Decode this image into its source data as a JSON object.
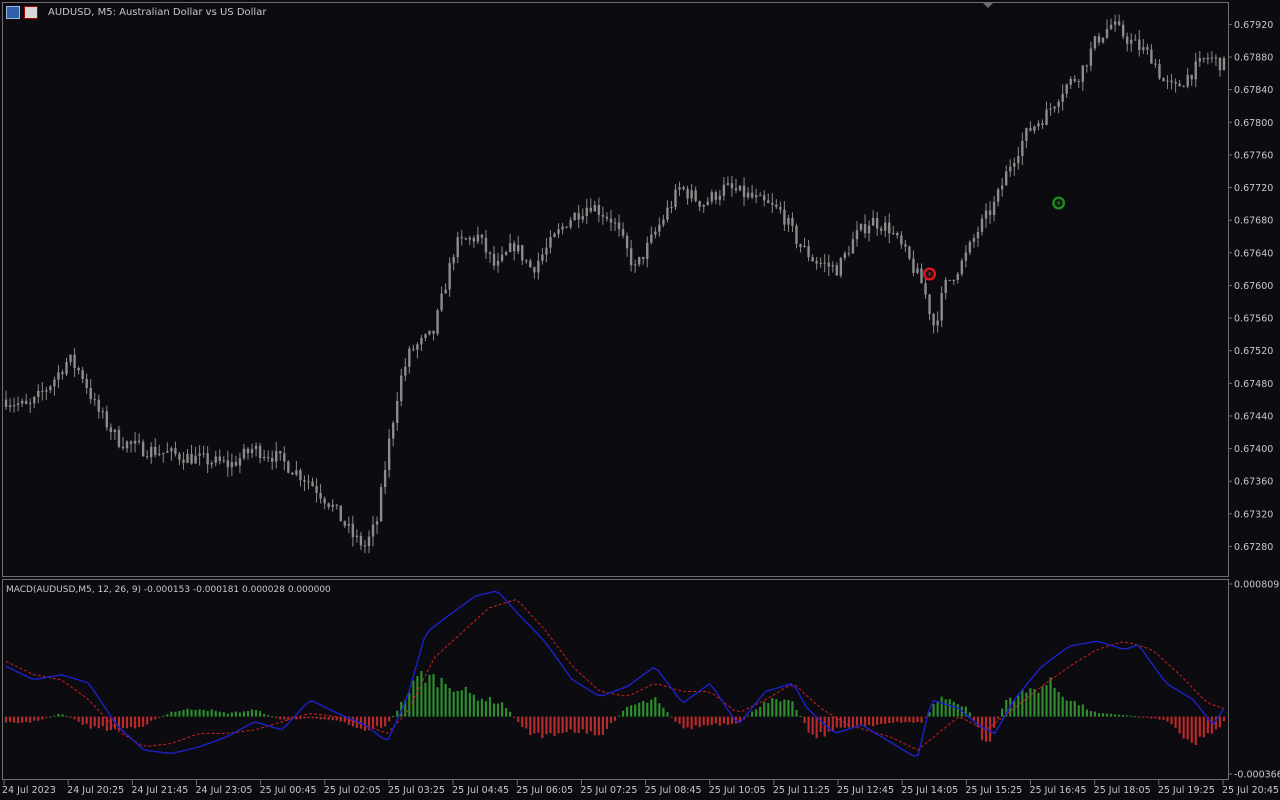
{
  "window": {
    "symbol_title": "AUDUSD, M5:  Australian Dollar vs US Dollar",
    "indicator_title": "MACD(AUDUSD,M5, 12, 26, 9) -0.000153 -0.000181 0.000028 0.000000"
  },
  "colors": {
    "background": "#0b0b10",
    "candle": "#8c8c8c",
    "frame": "#6e6e6e",
    "macd_line": "#1d22c8",
    "signal_line": "#d02020",
    "hist_up": "#2e8b2e",
    "hist_down": "#b52a2a",
    "sell_marker": "#e0141e",
    "buy_marker": "#1e8c1e"
  },
  "icons": [
    "chart-window-icon",
    "chart-properties-icon"
  ],
  "chart_data": [
    {
      "type": "candlestick",
      "title": "AUDUSD, M5:  Australian Dollar vs US Dollar",
      "y_ticks": [
        "0.67920",
        "0.67880",
        "0.67840",
        "0.67800",
        "0.67760",
        "0.67720",
        "0.67680",
        "0.67640",
        "0.67600",
        "0.67560",
        "0.67520",
        "0.67480",
        "0.67440",
        "0.67400",
        "0.67360",
        "0.67320",
        "0.67280"
      ],
      "ylim": [
        0.67245,
        0.67945
      ],
      "x_ticks": [
        "24 Jul 2023",
        "24 Jul 20:25",
        "24 Jul 21:45",
        "24 Jul 23:05",
        "25 Jul 00:45",
        "25 Jul 02:05",
        "25 Jul 03:25",
        "25 Jul 04:45",
        "25 Jul 06:05",
        "25 Jul 07:25",
        "25 Jul 08:45",
        "25 Jul 10:05",
        "25 Jul 11:25",
        "25 Jul 12:45",
        "25 Jul 14:05",
        "25 Jul 15:25",
        "25 Jul 16:45",
        "25 Jul 18:05",
        "25 Jul 19:25",
        "25 Jul 20:45"
      ],
      "bars": 303,
      "close_path": [
        [
          0,
          0.6746
        ],
        [
          10,
          0.6745
        ],
        [
          20,
          0.6748
        ],
        [
          28,
          0.6751
        ],
        [
          34,
          0.6749
        ],
        [
          40,
          0.6745
        ],
        [
          50,
          0.6741
        ],
        [
          60,
          0.674
        ],
        [
          80,
          0.6739
        ],
        [
          100,
          0.6738
        ],
        [
          110,
          0.674
        ],
        [
          120,
          0.6739
        ],
        [
          135,
          0.6736
        ],
        [
          145,
          0.6733
        ],
        [
          155,
          0.6729
        ],
        [
          160,
          0.6728
        ],
        [
          165,
          0.6731
        ],
        [
          170,
          0.674
        ],
        [
          175,
          0.6748
        ],
        [
          180,
          0.6752
        ],
        [
          190,
          0.6754
        ],
        [
          200,
          0.6765
        ],
        [
          210,
          0.6766
        ],
        [
          218,
          0.6762
        ],
        [
          226,
          0.6765
        ],
        [
          234,
          0.6762
        ],
        [
          242,
          0.6765
        ],
        [
          250,
          0.6768
        ],
        [
          260,
          0.677
        ],
        [
          270,
          0.6768
        ],
        [
          280,
          0.6762
        ],
        [
          290,
          0.6767
        ],
        [
          300,
          0.6772
        ],
        [
          310,
          0.677
        ],
        [
          320,
          0.6772
        ],
        [
          330,
          0.6771
        ],
        [
          345,
          0.6769
        ],
        [
          353,
          0.6765
        ],
        [
          360,
          0.6763
        ],
        [
          370,
          0.6762
        ],
        [
          378,
          0.6766
        ],
        [
          385,
          0.6768
        ],
        [
          393,
          0.6767
        ],
        [
          400,
          0.6764
        ],
        [
          408,
          0.676
        ],
        [
          413,
          0.6755
        ],
        [
          418,
          0.676
        ],
        [
          426,
          0.6763
        ],
        [
          433,
          0.6767
        ],
        [
          440,
          0.677
        ],
        [
          447,
          0.6775
        ],
        [
          455,
          0.6779
        ],
        [
          463,
          0.6781
        ],
        [
          470,
          0.6784
        ],
        [
          478,
          0.6786
        ],
        [
          485,
          0.679
        ],
        [
          492,
          0.6792
        ],
        [
          500,
          0.679
        ],
        [
          510,
          0.6788
        ],
        [
          515,
          0.6785
        ],
        [
          520,
          0.6784
        ],
        [
          527,
          0.6786
        ],
        [
          535,
          0.6788
        ],
        [
          542,
          0.6787
        ]
      ]
    },
    {
      "type": "macd",
      "title": "MACD(AUDUSD,M5, 12, 26, 9) -0.000153 -0.000181 0.000028 0.000000",
      "y_ticks": [
        "0.000809",
        "-0.000366"
      ],
      "ylim": [
        -0.000366,
        0.000809
      ],
      "macd_path": [
        [
          0,
          0.0003
        ],
        [
          10,
          0.00022
        ],
        [
          20,
          0.00025
        ],
        [
          30,
          0.0002
        ],
        [
          40,
          -5e-05
        ],
        [
          50,
          -0.0002
        ],
        [
          60,
          -0.00022
        ],
        [
          70,
          -0.00018
        ],
        [
          80,
          -0.00012
        ],
        [
          90,
          -3e-05
        ],
        [
          100,
          -8e-05
        ],
        [
          110,
          0.0001
        ],
        [
          120,
          2e-05
        ],
        [
          130,
          -5e-05
        ],
        [
          138,
          -0.00015
        ],
        [
          145,
          0.0001
        ],
        [
          152,
          0.0005
        ],
        [
          160,
          0.0006
        ],
        [
          170,
          0.00072
        ],
        [
          178,
          0.00075
        ],
        [
          185,
          0.00062
        ],
        [
          195,
          0.00045
        ],
        [
          205,
          0.00022
        ],
        [
          215,
          0.00012
        ],
        [
          225,
          0.00018
        ],
        [
          235,
          0.0003
        ],
        [
          245,
          8e-05
        ],
        [
          255,
          0.0002
        ],
        [
          265,
          -5e-05
        ],
        [
          275,
          0.00015
        ],
        [
          285,
          0.0002
        ],
        [
          290,
          5e-05
        ],
        [
          300,
          -0.0001
        ],
        [
          310,
          -5e-05
        ],
        [
          320,
          -0.00015
        ],
        [
          330,
          -0.00025
        ],
        [
          335,
          0.0001
        ],
        [
          345,
          5e-05
        ],
        [
          352,
          -5e-05
        ],
        [
          358,
          -0.0001
        ],
        [
          365,
          0.0001
        ],
        [
          375,
          0.0003
        ],
        [
          385,
          0.00042
        ],
        [
          395,
          0.00045
        ],
        [
          405,
          0.0004
        ],
        [
          410,
          0.00043
        ],
        [
          420,
          0.0002
        ],
        [
          430,
          0.0001
        ],
        [
          437,
          -5e-05
        ],
        [
          441,
          5e-05
        ]
      ],
      "signal_path": [
        [
          0,
          0.00033
        ],
        [
          10,
          0.00025
        ],
        [
          20,
          0.00022
        ],
        [
          30,
          0.0001
        ],
        [
          40,
          -8e-05
        ],
        [
          50,
          -0.00018
        ],
        [
          60,
          -0.00016
        ],
        [
          70,
          -0.0001
        ],
        [
          80,
          -0.0001
        ],
        [
          90,
          -8e-05
        ],
        [
          100,
          -3e-05
        ],
        [
          110,
          2e-05
        ],
        [
          120,
          0.0
        ],
        [
          130,
          -5e-05
        ],
        [
          138,
          -0.0001
        ],
        [
          145,
          2e-05
        ],
        [
          155,
          0.00035
        ],
        [
          165,
          0.0005
        ],
        [
          175,
          0.00065
        ],
        [
          185,
          0.0007
        ],
        [
          195,
          0.00052
        ],
        [
          205,
          0.0003
        ],
        [
          215,
          0.00015
        ],
        [
          225,
          0.00012
        ],
        [
          235,
          0.0002
        ],
        [
          245,
          0.00015
        ],
        [
          255,
          0.00015
        ],
        [
          265,
          2e-05
        ],
        [
          275,
          0.0001
        ],
        [
          285,
          0.0002
        ],
        [
          295,
          5e-05
        ],
        [
          305,
          -5e-05
        ],
        [
          320,
          -0.00012
        ],
        [
          330,
          -0.0002
        ],
        [
          345,
          0.0
        ],
        [
          355,
          -8e-05
        ],
        [
          365,
          5e-05
        ],
        [
          375,
          0.00018
        ],
        [
          385,
          0.0003
        ],
        [
          395,
          0.0004
        ],
        [
          405,
          0.00045
        ],
        [
          415,
          0.0004
        ],
        [
          425,
          0.00025
        ],
        [
          435,
          8e-05
        ],
        [
          441,
          5e-05
        ]
      ],
      "hist_path": [
        [
          0,
          -4e-05
        ],
        [
          10,
          -3e-05
        ],
        [
          20,
          2e-05
        ],
        [
          30,
          -6e-05
        ],
        [
          40,
          -8e-05
        ],
        [
          50,
          -5e-05
        ],
        [
          60,
          3e-05
        ],
        [
          70,
          5e-05
        ],
        [
          80,
          2e-05
        ],
        [
          90,
          4e-05
        ],
        [
          100,
          -2e-05
        ],
        [
          110,
          -1e-05
        ],
        [
          120,
          -2e-05
        ],
        [
          130,
          -8e-05
        ],
        [
          138,
          -5e-05
        ],
        [
          142,
          5e-05
        ],
        [
          150,
          0.00025
        ],
        [
          160,
          0.0002
        ],
        [
          170,
          0.00012
        ],
        [
          180,
          8e-05
        ],
        [
          185,
          -3e-05
        ],
        [
          192,
          -0.00012
        ],
        [
          205,
          -8e-05
        ],
        [
          215,
          -0.00012
        ],
        [
          225,
          6e-05
        ],
        [
          235,
          0.0001
        ],
        [
          245,
          -7e-05
        ],
        [
          255,
          -5e-05
        ],
        [
          265,
          -5e-05
        ],
        [
          275,
          0.0001
        ],
        [
          285,
          8e-05
        ],
        [
          292,
          -0.00012
        ],
        [
          305,
          -6e-05
        ],
        [
          320,
          -4e-05
        ],
        [
          332,
          -3e-05
        ],
        [
          338,
          0.00012
        ],
        [
          348,
          6e-05
        ],
        [
          355,
          -0.00018
        ],
        [
          362,
          0.0001
        ],
        [
          370,
          0.00015
        ],
        [
          378,
          0.0002
        ],
        [
          385,
          0.0001
        ],
        [
          395,
          2e-05
        ],
        [
          405,
          1e-05
        ],
        [
          420,
          -2e-05
        ],
        [
          430,
          -0.00016
        ],
        [
          440,
          -5e-05
        ],
        [
          441,
          -3e-05
        ]
      ]
    }
  ],
  "markers": [
    {
      "label": "0",
      "kind": "sell",
      "bar": 229,
      "price": 0.67614
    },
    {
      "label": "0",
      "kind": "buy",
      "bar": 261,
      "price": 0.67701
    }
  ]
}
